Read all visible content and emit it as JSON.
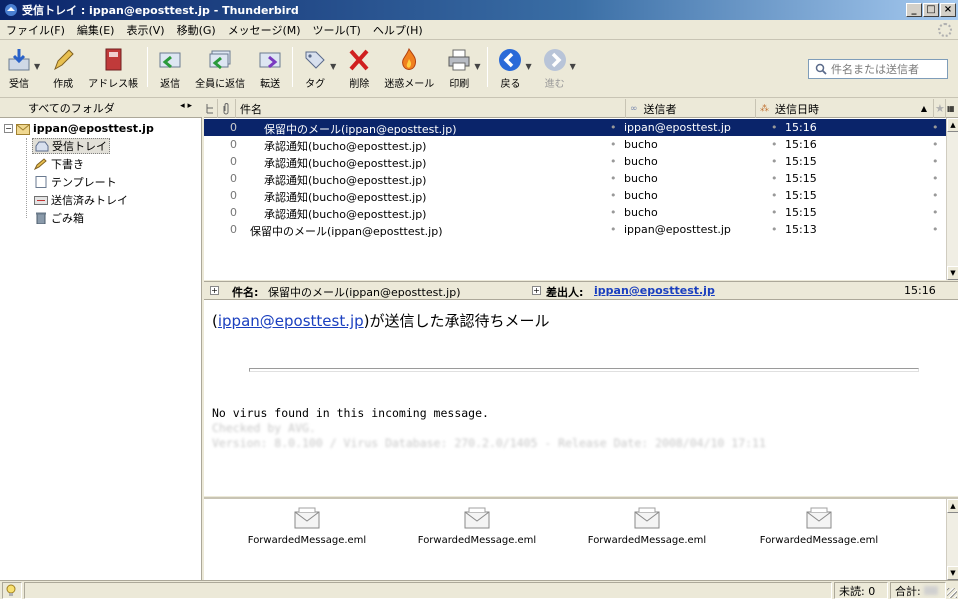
{
  "window": {
    "title": "受信トレイ : ippan@eposttest.jp - Thunderbird",
    "minimize": "_",
    "maximize": "□",
    "close": "×"
  },
  "menu": [
    "ファイル(F)",
    "編集(E)",
    "表示(V)",
    "移動(G)",
    "メッセージ(M)",
    "ツール(T)",
    "ヘルプ(H)"
  ],
  "toolbar": {
    "get_mail": "受信",
    "compose": "作成",
    "address_book": "アドレス帳",
    "reply": "返信",
    "reply_all": "全員に返信",
    "forward": "転送",
    "tag": "タグ",
    "delete": "削除",
    "junk": "迷惑メール",
    "print": "印刷",
    "back": "戻る",
    "forward_nav": "進む",
    "search_placeholder": "件名または送信者"
  },
  "folder_pane": {
    "header": "すべてのフォルダ",
    "header_arrows": "◂ ▸",
    "account": "ippan@eposttest.jp",
    "folders": [
      "受信トレイ",
      "下書き",
      "テンプレート",
      "送信済みトレイ",
      "ごみ箱"
    ]
  },
  "thread_pane": {
    "columns": {
      "subject": "件名",
      "sender": "送信者",
      "date": "送信日時"
    },
    "rows": [
      {
        "subject": "保留中のメール(ippan@eposttest.jp)",
        "sender": "ippan@eposttest.jp",
        "date": "15:16",
        "selected": true
      },
      {
        "subject": "承認通知(bucho@eposttest.jp)",
        "sender": "bucho",
        "date": "15:16",
        "selected": false
      },
      {
        "subject": "承認通知(bucho@eposttest.jp)",
        "sender": "bucho",
        "date": "15:15",
        "selected": false
      },
      {
        "subject": "承認通知(bucho@eposttest.jp)",
        "sender": "bucho",
        "date": "15:15",
        "selected": false
      },
      {
        "subject": "承認通知(bucho@eposttest.jp)",
        "sender": "bucho",
        "date": "15:15",
        "selected": false
      },
      {
        "subject": "承認通知(bucho@eposttest.jp)",
        "sender": "bucho",
        "date": "15:15",
        "selected": false
      },
      {
        "subject": "保留中のメール(ippan@eposttest.jp)",
        "sender": "ippan@eposttest.jp",
        "date": "15:13",
        "selected": false
      }
    ]
  },
  "message_header": {
    "subject_label": "件名:",
    "subject": "保留中のメール(ippan@eposttest.jp)",
    "from_label": "差出人:",
    "from": "ippan@eposttest.jp",
    "time": "15:16"
  },
  "message_body": {
    "line1_open": "(",
    "line1_link": "ippan@eposttest.jp",
    "line1_rest": ")が送信した承認待ちメール",
    "virus_line": "No virus found in this incoming message.",
    "checked_line": "Checked by AVG.",
    "version_line": "Version: 8.0.100 / Virus Database: 270.2.0/1405 - Release Date: 2008/04/10 17:11"
  },
  "attachments": [
    "ForwardedMessage.eml",
    "ForwardedMessage.eml",
    "ForwardedMessage.eml",
    "ForwardedMessage.eml"
  ],
  "status": {
    "unread_label": "未読: 0",
    "total_label": "合計:"
  },
  "colors": {
    "selection": "#0a246a",
    "link": "#1a3fbf",
    "chrome": "#ece9d8"
  }
}
